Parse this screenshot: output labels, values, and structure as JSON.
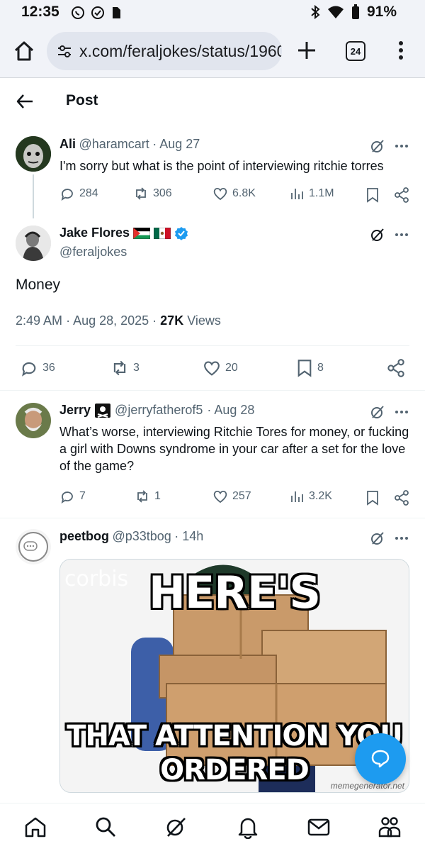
{
  "statusbar": {
    "time": "12:35",
    "battery": "91%"
  },
  "browser": {
    "url": "x.com/feraljokes/status/1960",
    "tab_count": "24"
  },
  "header": {
    "title": "Post"
  },
  "tweets": [
    {
      "name": "Ali",
      "handle": "@haramcart",
      "date": "· Aug 27",
      "text": "I'm sorry but what is the point of interviewing ritchie torres",
      "replies": "284",
      "reposts": "306",
      "likes": "6.8K",
      "views": "1.1M"
    },
    {
      "name": "Jerry",
      "handle": "@jerryfatherof5",
      "date": "· Aug 28",
      "text": "What’s worse, interviewing Ritchie Tores for money, or fucking a girl with Downs syndrome in your car after a set for the love of the game?",
      "replies": "7",
      "reposts": "1",
      "likes": "257",
      "views": "3.2K"
    },
    {
      "name": "peetbog",
      "handle": "@p33tbog",
      "date": "· 14h"
    }
  ],
  "main": {
    "name": "Jake Flores",
    "handle": "@feraljokes",
    "text": "Money",
    "time": "2:49 AM",
    "date": "· Aug 28, 2025 ·",
    "views_count": "27K",
    "views_label": "Views",
    "replies": "36",
    "reposts": "3",
    "likes": "20",
    "bookmarks": "8"
  },
  "meme": {
    "top_text": "HERE'S",
    "bottom_line1": "THAT ATTENTION YOU",
    "bottom_line2": "ORDERED",
    "watermark_left": "corbis",
    "watermark_right": "memegenerator.net"
  },
  "colors": {
    "accent": "#1d9bf0",
    "text": "#0f1419",
    "muted": "#536471",
    "verified": "#1d9bf0"
  }
}
